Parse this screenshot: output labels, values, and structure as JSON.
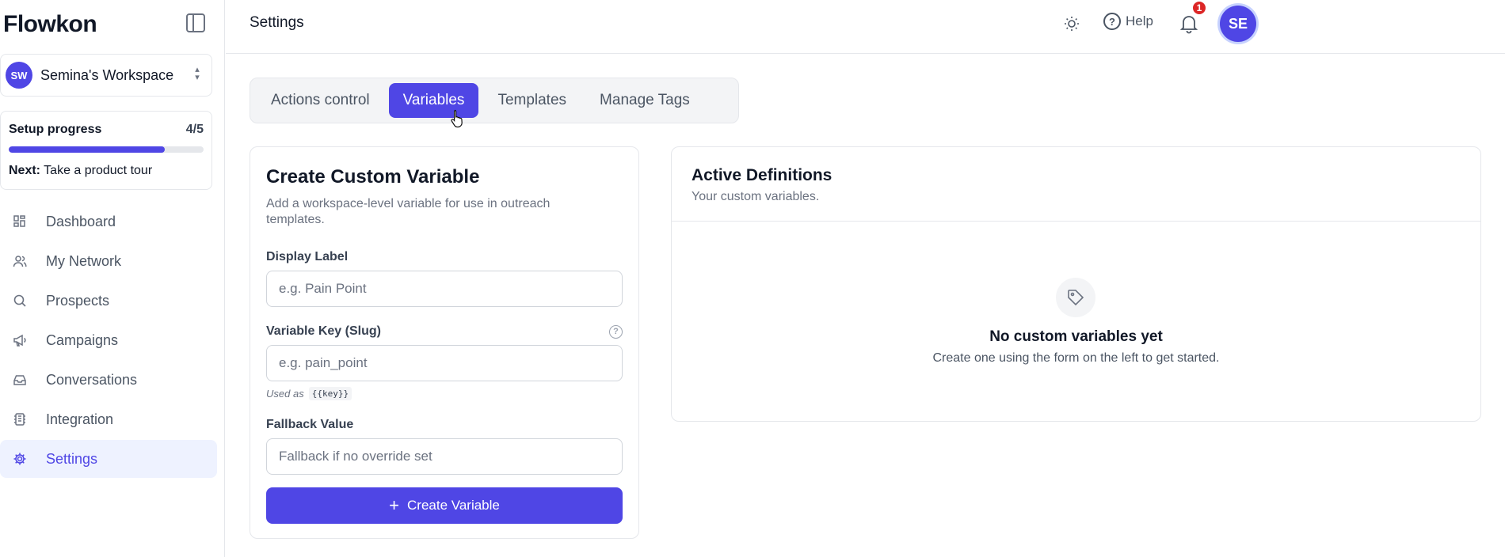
{
  "brand": {
    "logo_text": "Flowkon",
    "accent": "#4f46e5"
  },
  "workspace": {
    "initials": "SW",
    "name": "Semina's Workspace"
  },
  "setup": {
    "title": "Setup progress",
    "count": "4/5",
    "progress": 0.8,
    "next_label": "Next:",
    "next_text": "Take a product tour"
  },
  "sidebar": {
    "items": [
      {
        "label": "Dashboard",
        "icon": "grid-icon"
      },
      {
        "label": "My Network",
        "icon": "users-icon"
      },
      {
        "label": "Prospects",
        "icon": "search-icon"
      },
      {
        "label": "Campaigns",
        "icon": "megaphone-icon"
      },
      {
        "label": "Conversations",
        "icon": "inbox-icon"
      },
      {
        "label": "Integration",
        "icon": "integration-icon"
      },
      {
        "label": "Settings",
        "icon": "gear-icon"
      }
    ]
  },
  "header": {
    "title": "Settings",
    "help_label": "Help",
    "notification_count": "1",
    "avatar_initials": "SE"
  },
  "tabs": [
    {
      "label": "Actions control"
    },
    {
      "label": "Variables"
    },
    {
      "label": "Templates"
    },
    {
      "label": "Manage Tags"
    }
  ],
  "create_card": {
    "title": "Create Custom Variable",
    "subtitle": "Add a workspace-level variable for use in outreach templates.",
    "display_label": {
      "label": "Display Label",
      "placeholder": "e.g. Pain Point"
    },
    "variable_key": {
      "label": "Variable Key (Slug)",
      "placeholder": "e.g. pain_point",
      "used_as_text": "Used as",
      "used_as_code": "{{key}}"
    },
    "fallback": {
      "label": "Fallback Value",
      "placeholder": "Fallback if no override set"
    },
    "button_label": "Create Variable"
  },
  "definitions_card": {
    "title": "Active Definitions",
    "subtitle": "Your custom variables.",
    "empty_title": "No custom variables yet",
    "empty_subtitle": "Create one using the form on the left to get started."
  }
}
